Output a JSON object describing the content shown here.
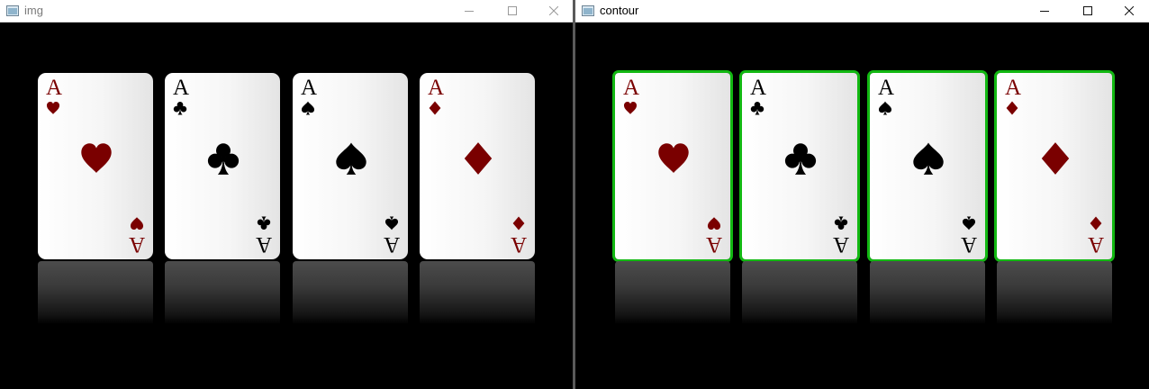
{
  "windows": [
    {
      "title": "img",
      "outlined": false
    },
    {
      "title": "contour",
      "outlined": true
    }
  ],
  "outline_color": "#12b812",
  "cards": [
    {
      "rank": "A",
      "suit": "hearts",
      "color": "#7a0000"
    },
    {
      "rank": "A",
      "suit": "clubs",
      "color": "#000000"
    },
    {
      "rank": "A",
      "suit": "spades",
      "color": "#000000"
    },
    {
      "rank": "A",
      "suit": "diamonds",
      "color": "#7a0000"
    }
  ]
}
